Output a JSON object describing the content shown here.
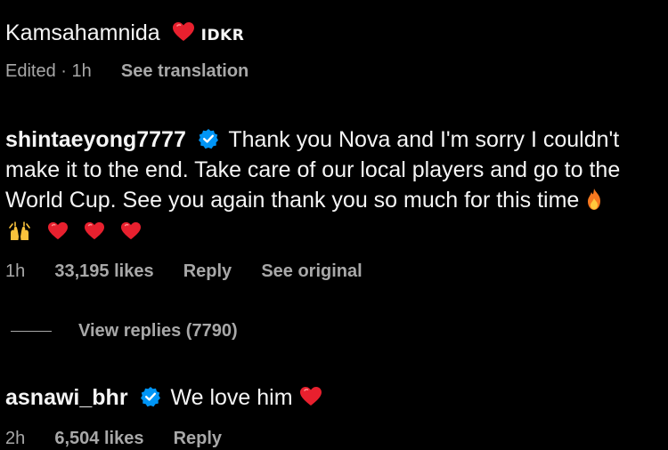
{
  "comment_top": {
    "text": "Kamsahamnida",
    "tag": "IDKR",
    "meta": {
      "edited": "Edited",
      "separator": "·",
      "time": "1h",
      "translate": "See translation"
    }
  },
  "comment_main": {
    "username": "shintaeyong7777",
    "line1": "Thank you Nova and I'm sorry I couldn't",
    "line2": "make it to the end. Take care of our local players and go to the",
    "line3": "World Cup. See you again thank you so much for this time",
    "meta": {
      "time": "1h",
      "likes": "33,195 likes",
      "reply": "Reply",
      "original": "See original"
    }
  },
  "replies": {
    "label": "View replies (7790)"
  },
  "comment_bottom": {
    "username": "asnawi_bhr",
    "text": "We love him",
    "meta": {
      "time": "2h",
      "likes": "6,504 likes",
      "reply": "Reply"
    }
  },
  "icons": {
    "verified": "verified-badge-icon",
    "heart": "red-heart-emoji",
    "flame": "fire-emoji",
    "hands": "raising-hands-emoji"
  },
  "colors": {
    "background": "#000000",
    "text": "#f5f5f5",
    "meta": "#a8a8a8",
    "verified": "#0095f6",
    "heart": "#e8202e"
  }
}
